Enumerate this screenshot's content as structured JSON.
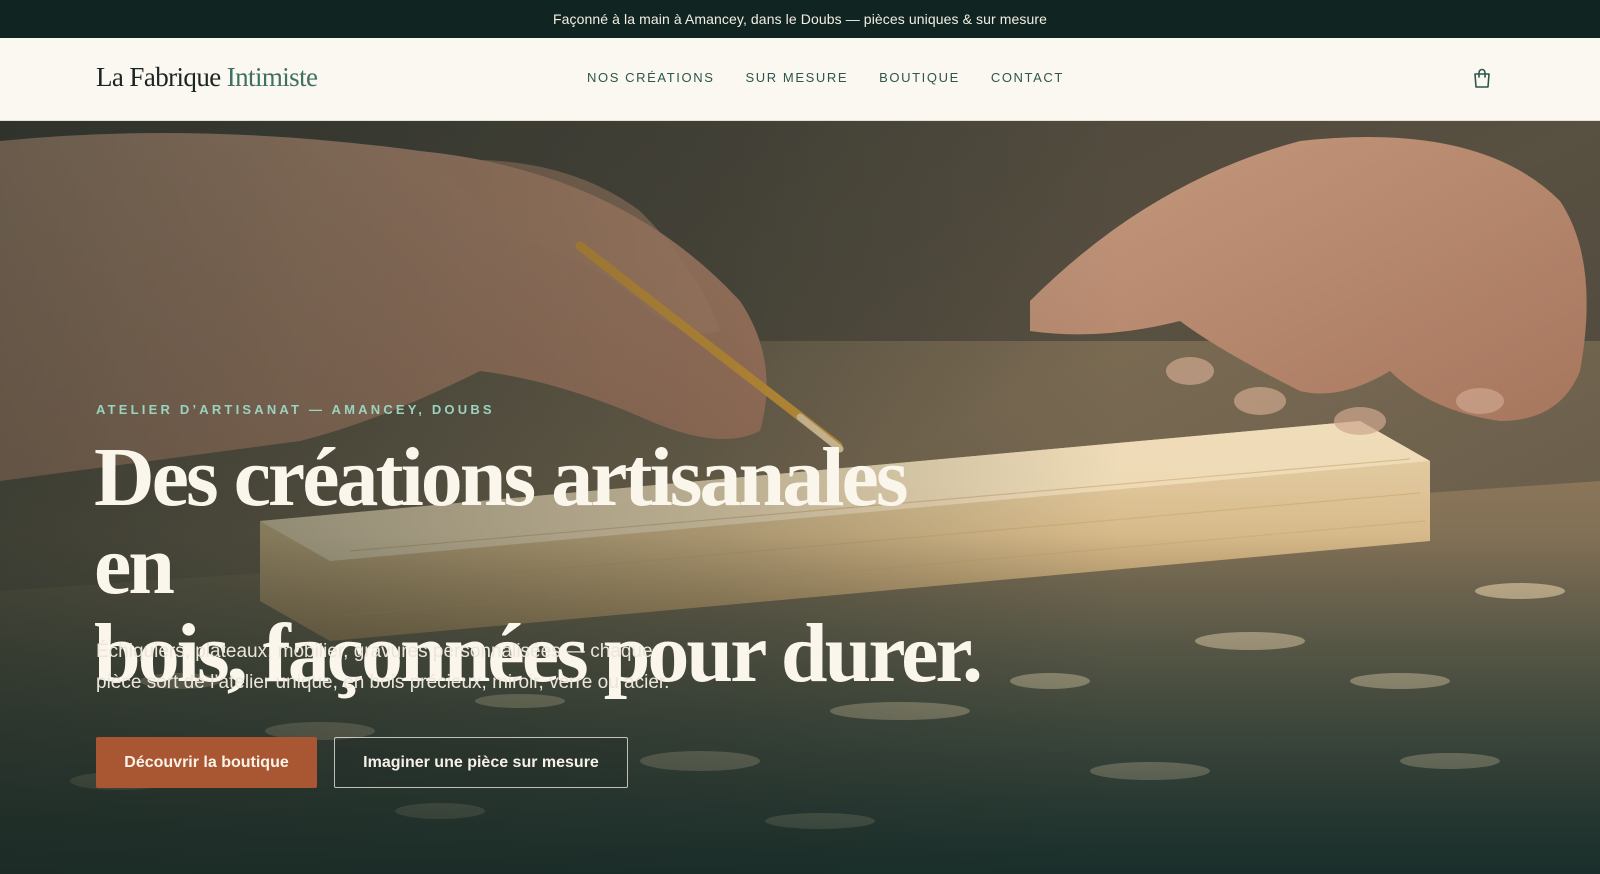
{
  "announcement": "Façonné à la main à Amancey, dans le Doubs — pièces uniques & sur mesure",
  "header": {
    "logo_main": "La Fabrique",
    "logo_accent": "Intimiste",
    "nav": [
      "NOS CRÉATIONS",
      "SUR MESURE",
      "BOUTIQUE",
      "CONTACT"
    ],
    "cart_icon": "shopping-bag-icon"
  },
  "hero": {
    "eyebrow": "ATELIER D’ARTISANAT — AMANCEY, DOUBS",
    "headline_line1": "Des créations artisanales en",
    "headline_line2": "bois, façonnées pour durer.",
    "subtitle_line1": "Échiquiers, plateaux, mobilier, gravures personnalisées — chaque",
    "subtitle_line2": "pièce sort de l’atelier unique, en bois précieux, miroir, verre ou acier.",
    "primary_button": "Découvrir la boutique",
    "secondary_button": "Imaginer une pièce sur mesure"
  },
  "colors": {
    "announcement_bg": "#102522",
    "header_bg": "#fbf8f1",
    "logo_accent": "#3f7065",
    "nav_text": "#2d564c",
    "eyebrow": "#9ad3bf",
    "primary_button": "#a85732"
  }
}
